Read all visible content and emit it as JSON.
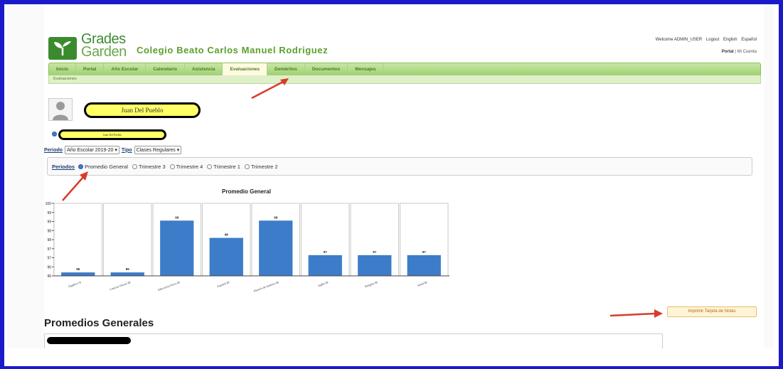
{
  "brand": {
    "logo_line1": "Grades",
    "logo_line2": "Garden",
    "school_name": "Colegio Beato Carlos Manuel Rodriguez"
  },
  "top_links": {
    "welcome": "Welcome ADMIN_USER",
    "logout": "Logout",
    "english": "English",
    "espanol": "Español",
    "portal": "Portal",
    "separator": "|",
    "mi_cuenta": "Mi Cuenta"
  },
  "nav": {
    "items": [
      {
        "label": "Inicio"
      },
      {
        "label": "Portal"
      },
      {
        "label": "Año Escolar"
      },
      {
        "label": "Calendario"
      },
      {
        "label": "Asistencia"
      },
      {
        "label": "Evaluaciones",
        "active": true
      },
      {
        "label": "Deméritos"
      },
      {
        "label": "Documentos"
      },
      {
        "label": "Mensajes"
      }
    ],
    "subnav": "Evaluaciones"
  },
  "student": {
    "name": "Juan Del Pueblo",
    "name_small": "Juan Del Pueblo"
  },
  "filters": {
    "periodo_label": "Periodo",
    "periodo_value": "Año Escolar 2019-20 ▾",
    "tipo_label": "Tipo",
    "tipo_value": "Clases Regulares ▾"
  },
  "periods": {
    "label": "Periodos",
    "options": [
      {
        "label": "Promedio General",
        "selected": true
      },
      {
        "label": "Trimestre 3"
      },
      {
        "label": "Trimestre 4"
      },
      {
        "label": "Trimestre 1"
      },
      {
        "label": "Trimestre 2"
      }
    ]
  },
  "chart_data": {
    "type": "bar",
    "title": "Promedio General",
    "categories": [
      "Álgebra I B",
      "Ciencias Físicas IB",
      "Educación Física IB",
      "Español IB",
      "Historia de América IB",
      "Inglés IB",
      "Religión IB",
      "Salud IB"
    ],
    "values": [
      96,
      96,
      99,
      98,
      99,
      97,
      97,
      97
    ],
    "value_labels": [
      "96",
      "96",
      "99",
      "98",
      "99",
      "97",
      "97",
      "97"
    ],
    "ylim": [
      95.8,
      100
    ],
    "yticks": [
      "100",
      "99",
      "99",
      "98",
      "98",
      "97",
      "97",
      "96",
      "96"
    ],
    "bar_color": "#3d7cc9",
    "grid": false
  },
  "promedios": {
    "title": "Promedios Generales"
  },
  "print_button": "Imprimir Tarjeta de Notas",
  "colors": {
    "frame": "#1a1acb",
    "brand_green": "#5aa02c",
    "nav_green": "#9fd170",
    "highlight": "#ffff66",
    "arrow": "#d93a2b"
  }
}
